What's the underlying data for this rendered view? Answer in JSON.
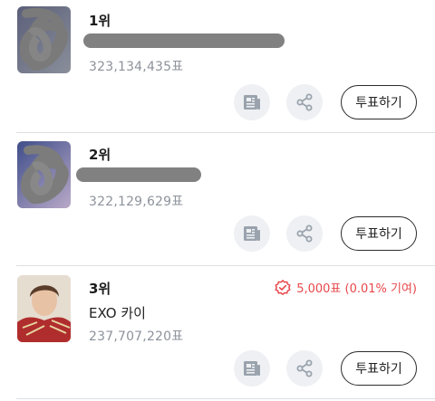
{
  "items": [
    {
      "rank": "1위",
      "name": "",
      "votes": "323,134,435표",
      "vote_button": "투표하기",
      "icons": [
        "article-icon",
        "share-icon"
      ]
    },
    {
      "rank": "2위",
      "name": "",
      "votes": "322,129,629표",
      "vote_button": "투표하기",
      "icons": [
        "article-icon",
        "share-icon"
      ]
    },
    {
      "rank": "3위",
      "name": "EXO 카이",
      "votes": "237,707,220표",
      "contribution": "5,000표 (0.01% 기여)",
      "vote_button": "투표하기",
      "icons": [
        "article-icon",
        "share-icon",
        "verified-badge-icon"
      ]
    }
  ],
  "colors": {
    "accent_red": "#e8474b",
    "muted_text": "#8d939b",
    "icon_bg": "#eef0f3",
    "icon_fg": "#9aa3ad"
  }
}
